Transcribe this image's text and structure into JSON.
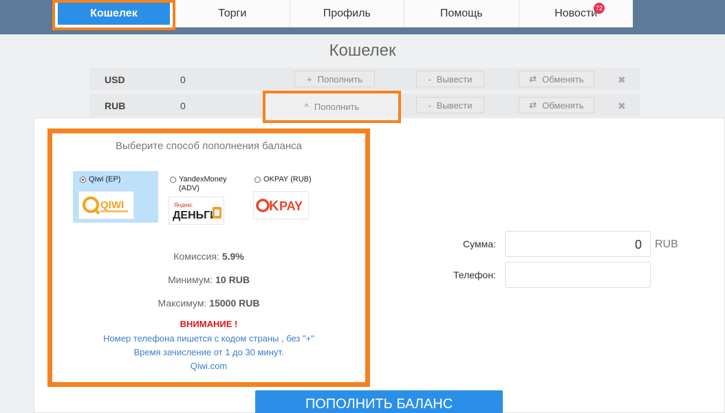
{
  "nav": {
    "items": [
      {
        "label": "Кошелек"
      },
      {
        "label": "Торги"
      },
      {
        "label": "Профиль"
      },
      {
        "label": "Помощь"
      },
      {
        "label": "Новости"
      }
    ],
    "news_badge": "72"
  },
  "page_title": "Кошелек",
  "wallet": {
    "rows": [
      {
        "currency": "USD",
        "balance": "0",
        "topup": "Пополнить",
        "withdraw": "Вывести",
        "exchange": "Обменять"
      },
      {
        "currency": "RUB",
        "balance": "0",
        "topup": "Пополнить",
        "withdraw": "Вывести",
        "exchange": "Обменять"
      }
    ],
    "icons": {
      "plus": "+",
      "minus": "-",
      "exchange": "⇄",
      "chevron_up": "^",
      "close": "✖"
    }
  },
  "topup": {
    "title": "Выберите способ пополнения баланса",
    "methods": [
      {
        "label": "Qiwi (EP)",
        "selected": true
      },
      {
        "label_line1": "YandexMoney",
        "label_line2": "(ADV)",
        "selected": false
      },
      {
        "label": "OKPAY (RUB)",
        "selected": false
      }
    ],
    "commission_label": "Комиссия:",
    "commission_value": "5.9%",
    "min_label": "Минимум:",
    "min_value": "10 RUB",
    "max_label": "Максимум:",
    "max_value": "15000 RUB",
    "warning": "ВНИМАНИЕ !",
    "note1": "Номер телефона пишется с кодом страны , без \"+\"",
    "note2": "Время зачисление от 1 до 30 минут.",
    "link": "Qiwi.com"
  },
  "form": {
    "amount_label": "Сумма:",
    "amount_value": "0",
    "amount_unit": "RUB",
    "phone_label": "Телефон:",
    "phone_value": ""
  },
  "submit_label": "ПОПОЛНИТЬ БАЛАНС",
  "colors": {
    "accent": "#2b8fe8",
    "highlight": "#f5821f",
    "warning": "#e0141e",
    "link": "#3b7ec9"
  }
}
